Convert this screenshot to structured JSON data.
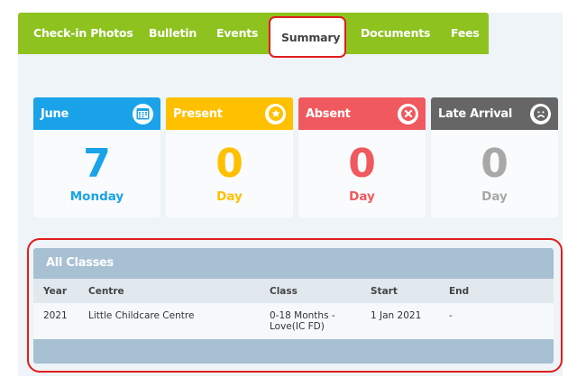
{
  "tabs": [
    {
      "label": "Check-in Photos",
      "active": false
    },
    {
      "label": "Bulletin",
      "active": false
    },
    {
      "label": "Events",
      "active": false
    },
    {
      "label": "Summary",
      "active": true
    },
    {
      "label": "Documents",
      "active": false
    },
    {
      "label": "Fees",
      "active": false
    }
  ],
  "cards": [
    {
      "title": "June",
      "value": "7",
      "sub": "Monday",
      "color": "#1aa3e8",
      "icon": "calendar-icon"
    },
    {
      "title": "Present",
      "value": "0",
      "sub": "Day",
      "color": "#ffc000",
      "icon": "star-icon"
    },
    {
      "title": "Absent",
      "value": "0",
      "sub": "Day",
      "color": "#f0595e",
      "icon": "x-circle-icon"
    },
    {
      "title": "Late Arrival",
      "value": "0",
      "sub": "Day",
      "color": "#666666",
      "icon": "sad-face-icon"
    }
  ],
  "card_colors": {
    "value_0": "#1aa3e8",
    "value_1": "#ffc000",
    "value_2": "#f0595e",
    "value_3": "#a8a8a8"
  },
  "classes": {
    "title": "All Classes",
    "columns": [
      "Year",
      "Centre",
      "Class",
      "Start",
      "End"
    ],
    "rows": [
      {
        "year": "2021",
        "centre": "Little Childcare Centre",
        "class": "0-18 Months - Love(IC FD)",
        "start": "1 Jan 2021",
        "end": "-"
      }
    ]
  }
}
